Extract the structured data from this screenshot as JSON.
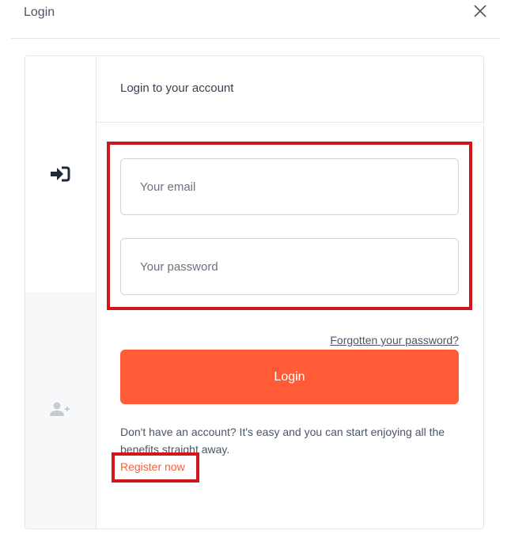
{
  "dialog": {
    "title": "Login",
    "close_label": "×"
  },
  "side_rail": {
    "login_icon": "sign-in-arrow-icon",
    "register_icon": "user-plus-icon"
  },
  "form": {
    "title": "Login to your account",
    "email_placeholder": "Your email",
    "password_placeholder": "Your password",
    "email_value": "",
    "password_value": "",
    "forgot_label": "Forgotten your password?",
    "login_button_label": "Login",
    "register_prompt": "Don't have an account? It's easy and you can start enjoying all the benefits straight away.",
    "register_link_label": "Register now"
  },
  "colors": {
    "accent": "#ff5b37",
    "highlight": "#d1151b",
    "rail_inactive_bg": "#f7f8fa"
  }
}
